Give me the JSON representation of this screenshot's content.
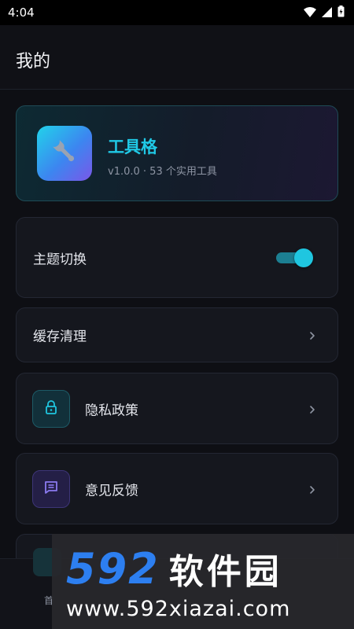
{
  "status": {
    "time": "4:04"
  },
  "header": {
    "title": "我的"
  },
  "app_card": {
    "name": "工具格",
    "meta": "v1.0.0 · 53 个实用工具"
  },
  "settings": {
    "theme_label": "主题切换",
    "theme_on": true,
    "cache_label": "缓存清理",
    "privacy_label": "隐私政策",
    "feedback_label": "意见反馈"
  },
  "bottom_nav": {
    "label": "首"
  },
  "watermark": {
    "number": "592",
    "text": "软件园",
    "url": "www.592xiazai.com"
  },
  "colors": {
    "accent": "#1fc6e0",
    "purple": "#8a7af0"
  },
  "icons": [
    "wifi-icon",
    "signal-icon",
    "battery-icon",
    "wrench-icon",
    "chevron-right-icon",
    "lock-icon",
    "message-icon"
  ]
}
